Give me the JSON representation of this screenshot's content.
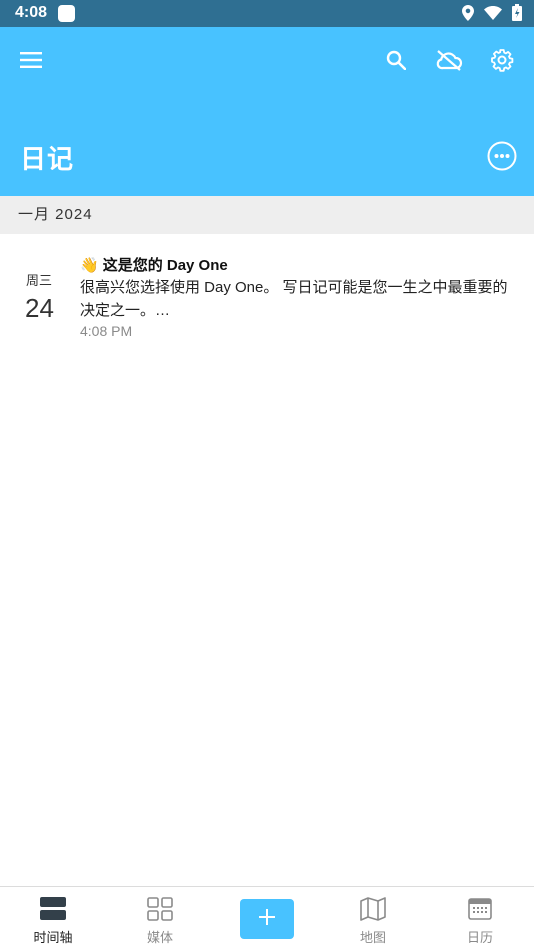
{
  "status_bar": {
    "time": "4:08"
  },
  "app_bar": {
    "title": "日记"
  },
  "month_header": "一月 2024",
  "entries": [
    {
      "weekday": "周三",
      "day": "24",
      "emoji": "👋",
      "title": "这是您的 Day One",
      "body": "很高兴您选择使用 Day One。 写日记可能是您一生之中最重要的决定之一。…",
      "time": "4:08 PM"
    }
  ],
  "bottom_nav": {
    "timeline": "时间轴",
    "media": "媒体",
    "map": "地图",
    "calendar": "日历"
  },
  "icons": {
    "menu": "menu-icon",
    "search": "search-icon",
    "cloud": "cloud-off-icon",
    "settings": "gear-icon",
    "more": "more-horizontal-icon",
    "add": "plus-icon"
  },
  "colors": {
    "status_bar": "#2f6f92",
    "app_bar": "#48c2ff",
    "accent": "#48c2ff",
    "month_header_bg": "#eeeeee"
  }
}
